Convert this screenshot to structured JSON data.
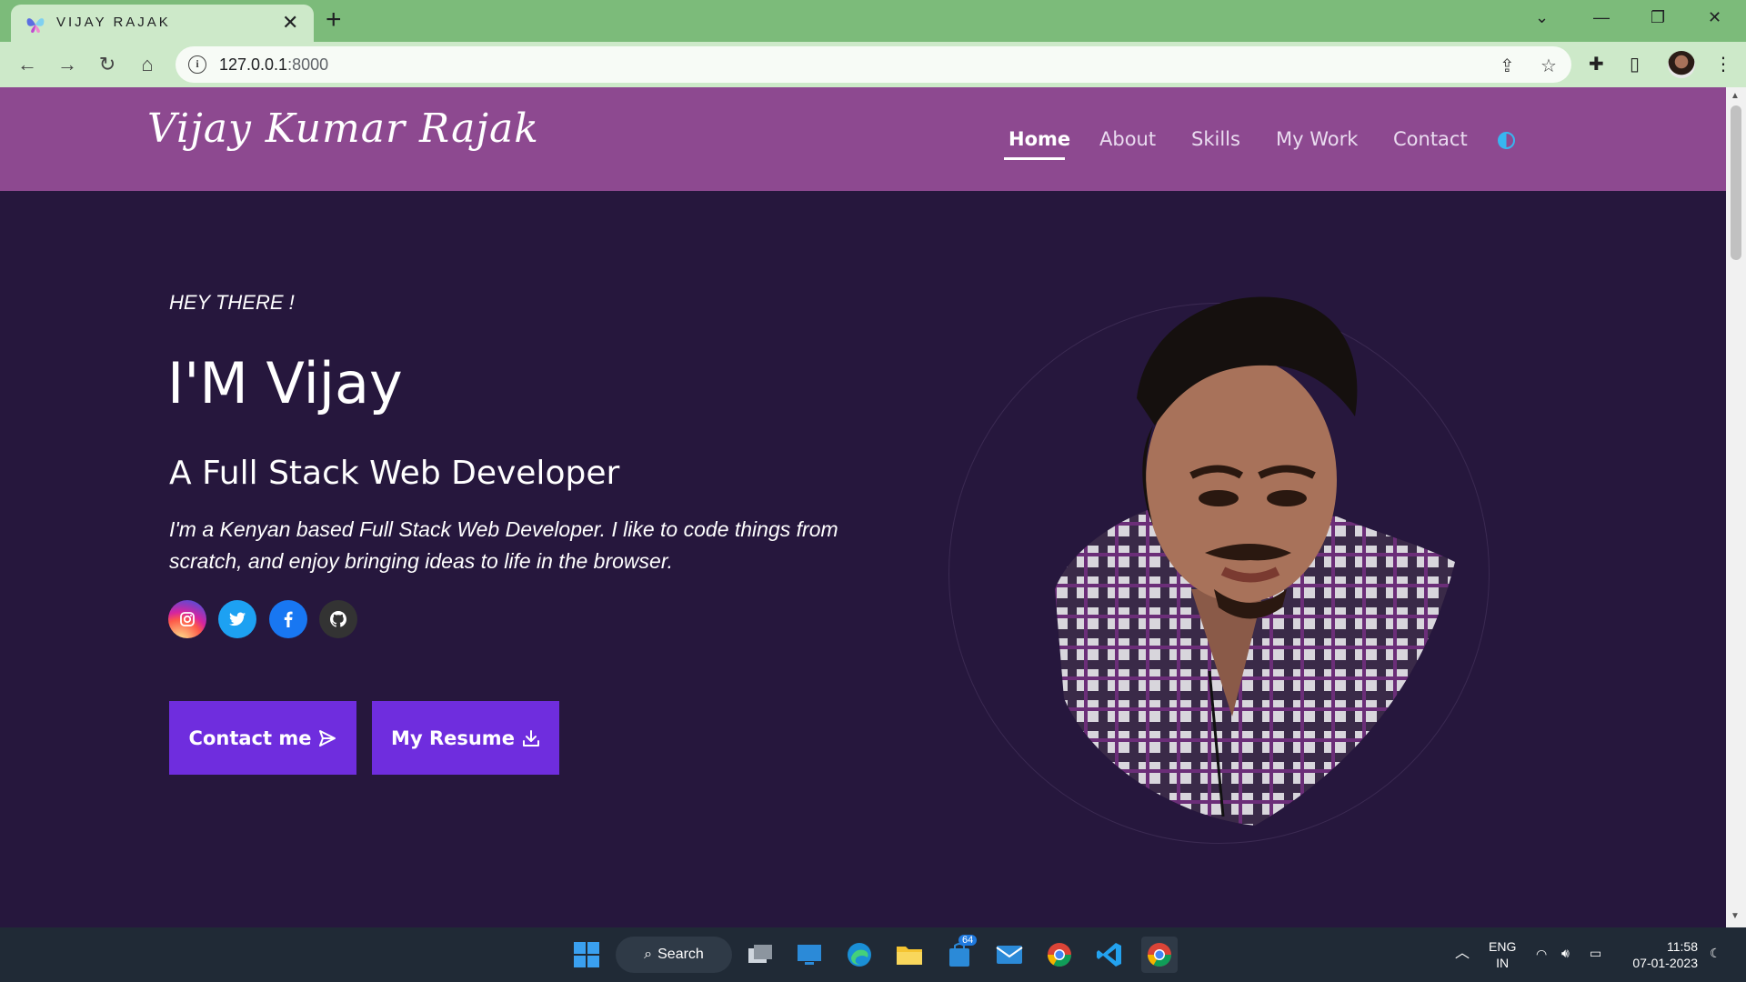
{
  "browser": {
    "tab_title": "VIJAY RAJAK",
    "url_host": "127.0.0.1",
    "url_port": ":8000"
  },
  "site": {
    "logo": "Vijay Kumar Rajak",
    "nav": {
      "home": "Home",
      "about": "About",
      "skills": "Skills",
      "work": "My Work",
      "contact": "Contact"
    }
  },
  "hero": {
    "greeting": "HEY THERE !",
    "name": "I'M Vijay",
    "role": "A Full Stack Web Developer",
    "description": "I'm a Kenyan based Full Stack Web Developer. I like to code things from scratch, and enjoy bringing ideas to life in the browser.",
    "buttons": {
      "contact": "Contact me",
      "resume": "My Resume"
    }
  },
  "taskbar": {
    "search_label": "Search",
    "badge_count": "64",
    "lang_top": "ENG",
    "lang_bottom": "IN",
    "time": "11:58",
    "date": "07-01-2023"
  }
}
